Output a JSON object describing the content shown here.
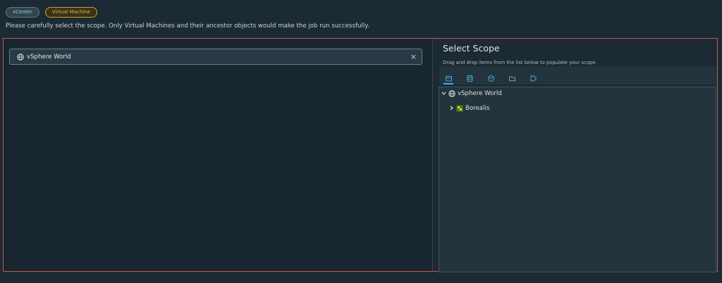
{
  "tags": [
    {
      "label": "vCenter"
    },
    {
      "label": "Virtual Machine"
    }
  ],
  "notice": "Please carefully select the scope. Only Virtual Machines and their ancestor objects would make the job run successfully.",
  "selected": {
    "label": "vSphere World",
    "close_glyph": "×",
    "icon": "globe-icon"
  },
  "panel": {
    "title": "Select Scope",
    "subtitle": "Drag and drop items from the list below to populate your scope.",
    "toolbar": [
      "hosts-clusters-icon",
      "datastore-icon",
      "network-icon",
      "folder-icon",
      "tag-icon"
    ],
    "active_tool": 0
  },
  "tree": [
    {
      "label": "vSphere World",
      "icon": "globe-icon",
      "expanded": true
    },
    {
      "label": "Borealis",
      "icon": "datacenter-icon",
      "expanded": false
    }
  ],
  "colors": {
    "accent": "#49aee0",
    "frame_border": "#c25a55",
    "vm_tag": "#d7b449"
  }
}
